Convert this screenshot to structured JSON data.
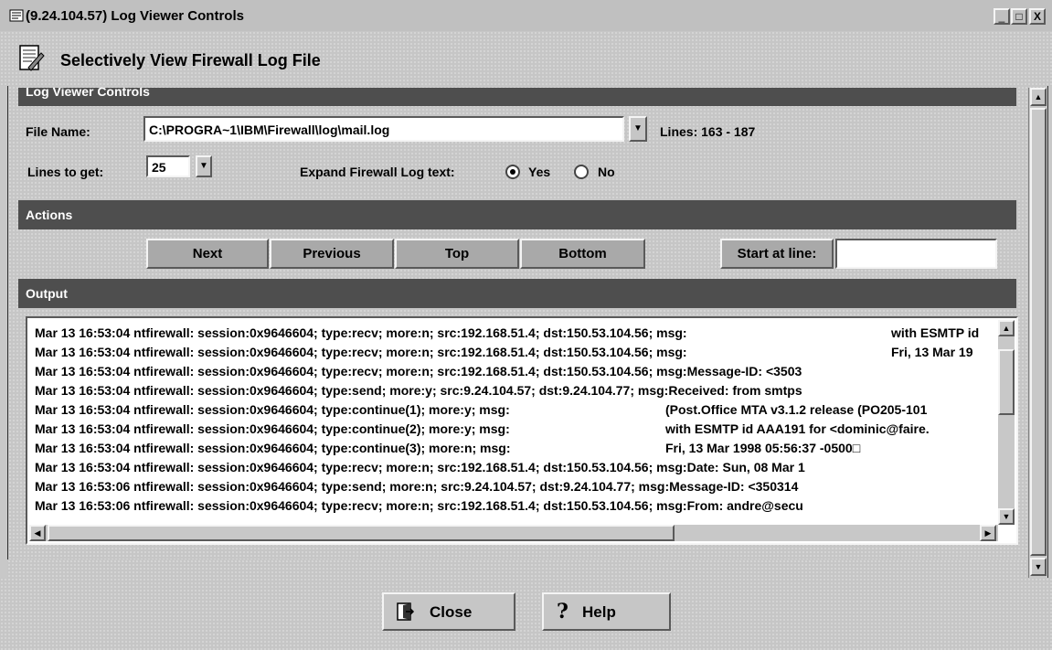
{
  "window": {
    "title": "(9.24.104.57) Log Viewer Controls",
    "minimize_label": "_",
    "maximize_label": "□",
    "close_label": "X"
  },
  "header": {
    "title": "Selectively View Firewall Log File"
  },
  "sections": {
    "log_viewer_controls": "Log Viewer Controls",
    "actions": "Actions",
    "output": "Output"
  },
  "controls": {
    "file_name_label": "File Name:",
    "file_name_value": "C:\\PROGRA~1\\IBM\\Firewall\\log\\mail.log",
    "lines_range": "Lines: 163 - 187",
    "lines_to_get_label": "Lines to get:",
    "lines_to_get_value": "25",
    "expand_label": "Expand Firewall Log text:",
    "expand_yes": "Yes",
    "expand_no": "No",
    "expand_selected": "Yes"
  },
  "actions": {
    "next": "Next",
    "previous": "Previous",
    "top": "Top",
    "bottom": "Bottom",
    "start_at_line_label": "Start at line:",
    "start_at_line_value": ""
  },
  "output": {
    "lines": [
      {
        "main": "Mar 13 16:53:04 ntfirewall: session:0x9646604; type:recv; more:n; src:192.168.51.4; dst:150.53.104.56; msg:",
        "tail": "with ESMTP id"
      },
      {
        "main": "Mar 13 16:53:04 ntfirewall: session:0x9646604; type:recv; more:n; src:192.168.51.4; dst:150.53.104.56; msg:",
        "tail": "Fri, 13 Mar 19"
      },
      {
        "main": "Mar 13 16:53:04 ntfirewall: session:0x9646604; type:recv; more:n; src:192.168.51.4; dst:150.53.104.56; msg:Message-ID: <3503",
        "tail": ""
      },
      {
        "main": "Mar 13 16:53:04 ntfirewall: session:0x9646604; type:send; more:y; src:9.24.104.57; dst:9.24.104.77; msg:Received: from smtps",
        "tail": ""
      },
      {
        "main": "Mar 13 16:53:04 ntfirewall: session:0x9646604; type:continue(1); more:y; msg:",
        "tail": "(Post.Office MTA v3.1.2 release (PO205-101"
      },
      {
        "main": "Mar 13 16:53:04 ntfirewall: session:0x9646604; type:continue(2); more:y; msg:",
        "tail": "with ESMTP id AAA191 for <dominic@faire."
      },
      {
        "main": "Mar 13 16:53:04 ntfirewall: session:0x9646604; type:continue(3); more:n; msg:",
        "tail": "Fri, 13 Mar 1998 05:56:37 -0500□"
      },
      {
        "main": "Mar 13 16:53:04 ntfirewall: session:0x9646604; type:recv; more:n; src:192.168.51.4; dst:150.53.104.56; msg:Date: Sun, 08 Mar 1",
        "tail": ""
      },
      {
        "main": "Mar 13 16:53:06 ntfirewall: session:0x9646604; type:send; more:n; src:9.24.104.57; dst:9.24.104.77; msg:Message-ID: <350314",
        "tail": ""
      },
      {
        "main": "Mar 13 16:53:06 ntfirewall: session:0x9646604; type:recv; more:n; src:192.168.51.4; dst:150.53.104.56; msg:From: andre@secu",
        "tail": ""
      }
    ]
  },
  "buttons": {
    "close": "Close",
    "help": "Help"
  }
}
